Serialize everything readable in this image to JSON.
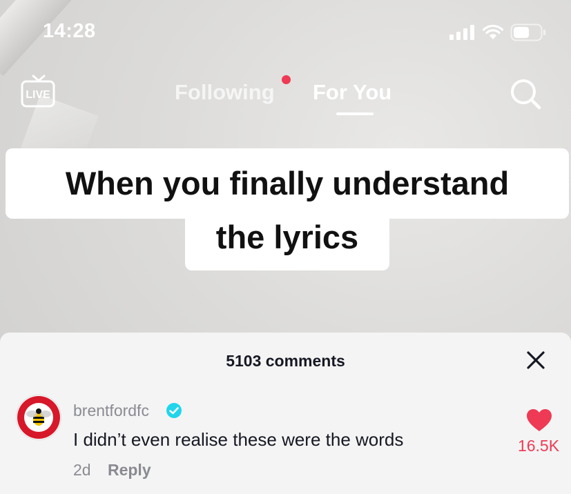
{
  "status_bar": {
    "time": "14:28",
    "icons": [
      "cellular-signal-icon",
      "wifi-icon",
      "battery-icon"
    ]
  },
  "nav": {
    "live_label": "LIVE",
    "tabs": [
      {
        "label": "Following",
        "active": false,
        "has_dot": true
      },
      {
        "label": "For You",
        "active": true
      }
    ],
    "accent_color": "#ee3a55"
  },
  "video": {
    "caption_line1": "When you finally understand",
    "caption_line2": "the lyrics"
  },
  "comments": {
    "count_label": "5103 comments",
    "items": [
      {
        "username": "brentfordfc",
        "verified": true,
        "text": "I didn’t even realise these were the words",
        "age": "2d",
        "reply_label": "Reply",
        "likes": "16.5K",
        "liked": true
      }
    ]
  }
}
